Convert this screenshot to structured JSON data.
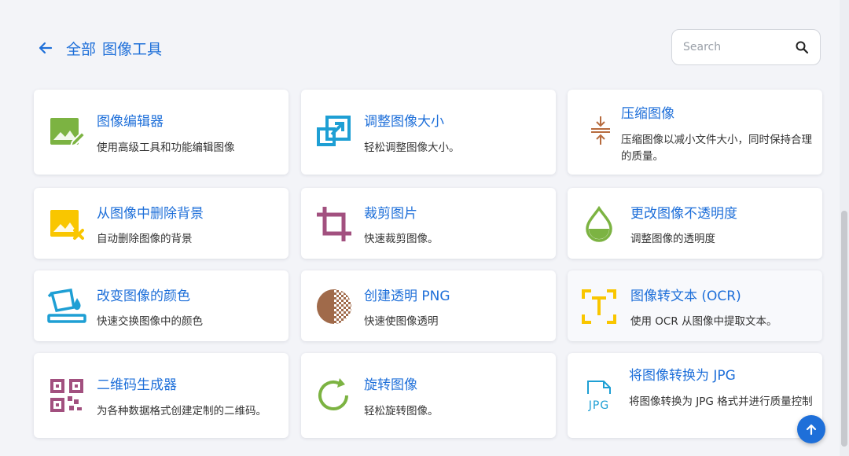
{
  "header": {
    "breadcrumb_all": "全部",
    "breadcrumb_current": "图像工具"
  },
  "search": {
    "placeholder": "Search"
  },
  "colors": {
    "accent": "#1e6fd9",
    "green": "#7cb342",
    "yellow": "#f9c600",
    "purple": "#a2507f",
    "cyan": "#1e9fd4",
    "brown": "#a06a4a",
    "orange_brown": "#b76b3e"
  },
  "tools": [
    {
      "title": "图像编辑器",
      "desc": "使用高级工具和功能编辑图像",
      "icon": "image-edit-icon"
    },
    {
      "title": "调整图像大小",
      "desc": "轻松调整图像大小。",
      "icon": "resize-icon"
    },
    {
      "title": "压缩图像",
      "desc": "压缩图像以减小文件大小，同时保持合理的质量。",
      "icon": "compress-icon"
    },
    {
      "title": "从图像中删除背景",
      "desc": "自动删除图像的背景",
      "icon": "remove-background-icon"
    },
    {
      "title": "裁剪图片",
      "desc": "快速裁剪图像。",
      "icon": "crop-icon"
    },
    {
      "title": "更改图像不透明度",
      "desc": "调整图像的透明度",
      "icon": "opacity-drop-icon"
    },
    {
      "title": "改变图像的颜色",
      "desc": "快速交换图像中的颜色",
      "icon": "paint-bucket-icon"
    },
    {
      "title": "创建透明 PNG",
      "desc": "快速使图像透明",
      "icon": "transparent-png-icon"
    },
    {
      "title": "图像转文本 (OCR)",
      "desc": "使用 OCR 从图像中提取文本。",
      "icon": "ocr-text-icon"
    },
    {
      "title": "二维码生成器",
      "desc": "为各种数据格式创建定制的二维码。",
      "icon": "qr-code-icon"
    },
    {
      "title": "旋转图像",
      "desc": "轻松旋转图像。",
      "icon": "rotate-icon"
    },
    {
      "title": "将图像转换为 JPG",
      "desc": "将图像转换为 JPG 格式并进行质量控制",
      "icon": "jpg-file-icon"
    }
  ]
}
